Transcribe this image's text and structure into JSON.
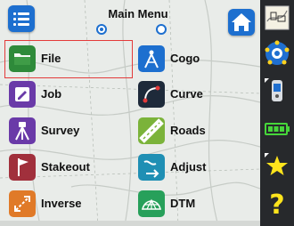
{
  "header": {
    "title": "Main Menu",
    "page_indicator": {
      "pages": 2,
      "current": 1
    },
    "menu_icon": "list-menu-icon",
    "home_icon": "home-icon"
  },
  "menu": {
    "left": [
      {
        "label": "File",
        "icon": "folder-icon",
        "color": "#2e8a3a",
        "selected": true
      },
      {
        "label": "Job",
        "icon": "job-icon",
        "color": "#6a3aa8"
      },
      {
        "label": "Survey",
        "icon": "tripod-icon",
        "color": "#6a3aa8"
      },
      {
        "label": "Stakeout",
        "icon": "stake-flag-icon",
        "color": "#a1303c"
      },
      {
        "label": "Inverse",
        "icon": "inverse-icon",
        "color": "#e07a28"
      }
    ],
    "right": [
      {
        "label": "Cogo",
        "icon": "compass-icon",
        "color": "#1d6fcf"
      },
      {
        "label": "Curve",
        "icon": "curve-icon",
        "color": "#1e2a3a"
      },
      {
        "label": "Roads",
        "icon": "road-icon",
        "color": "#7bb33a"
      },
      {
        "label": "Adjust",
        "icon": "adjust-icon",
        "color": "#1f8fb4"
      },
      {
        "label": "DTM",
        "icon": "dtm-mesh-icon",
        "color": "#27a05a"
      }
    ]
  },
  "sidebar": {
    "items": [
      {
        "icon": "map-icon"
      },
      {
        "icon": "satellite-icon"
      },
      {
        "icon": "gps-receiver-icon"
      },
      {
        "icon": "battery-icon",
        "level": 1.0
      },
      {
        "icon": "star-icon"
      },
      {
        "icon": "help-icon"
      }
    ]
  },
  "colors": {
    "accent": "#1d6fcf",
    "selection_border": "#e33a3a",
    "sidebar_bg": "#27292c",
    "battery": "#46d63a",
    "star": "#ffe41c"
  }
}
